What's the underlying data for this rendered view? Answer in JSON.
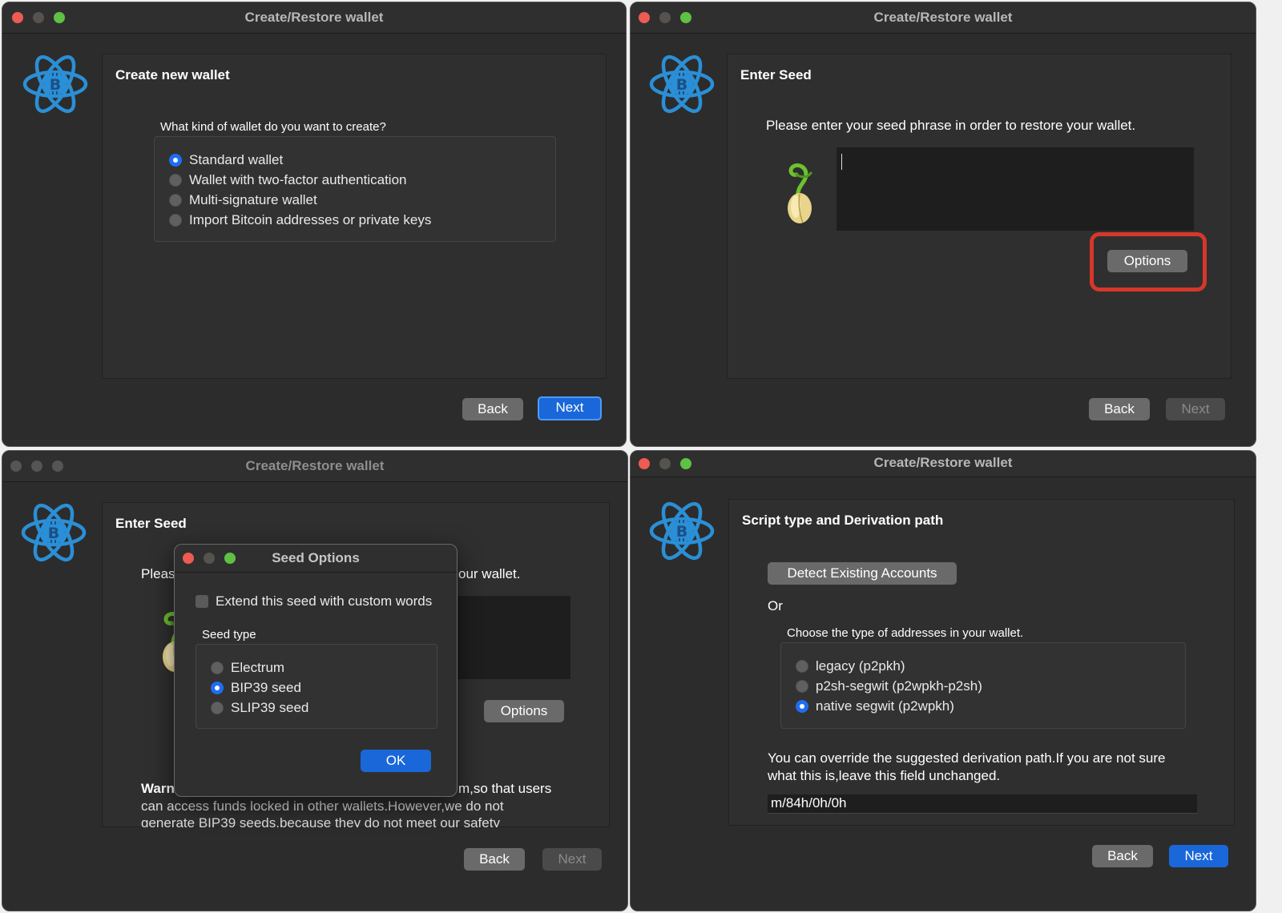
{
  "windows": {
    "top_left": {
      "title": "Create/Restore wallet",
      "heading": "Create new wallet",
      "question": "What kind of wallet do you want to create?",
      "options": [
        {
          "label": "Standard wallet",
          "checked": true
        },
        {
          "label": "Wallet with two-factor authentication",
          "checked": false
        },
        {
          "label": "Multi-signature wallet",
          "checked": false
        },
        {
          "label": "Import Bitcoin addresses or private keys",
          "checked": false
        }
      ],
      "back_label": "Back",
      "next_label": "Next"
    },
    "top_right": {
      "title": "Create/Restore wallet",
      "heading": "Enter Seed",
      "instruction": "Please enter your seed phrase in order to restore your wallet.",
      "seed_value": "",
      "options_label": "Options",
      "back_label": "Back",
      "next_label": "Next",
      "highlight_color": "#d6372a"
    },
    "bottom_left": {
      "title": "Create/Restore wallet",
      "heading": "Enter Seed",
      "instruction_left": "Pleas",
      "instruction_right": "our wallet.",
      "options_label": "Options",
      "warning_bold": "Warn",
      "warning_line1_right": "m,so that users",
      "warning_line2": "can access funds locked in other wallets.However,we do not",
      "warning_line3": "generate BIP39 seeds,because they do not meet our safety",
      "back_label": "Back",
      "next_label": "Next",
      "dialog": {
        "title": "Seed Options",
        "extend_label": "Extend this seed with custom words",
        "extend_checked": false,
        "seed_type_label": "Seed type",
        "seed_types": [
          {
            "label": "Electrum",
            "checked": false
          },
          {
            "label": "BIP39 seed",
            "checked": true
          },
          {
            "label": "SLIP39 seed",
            "checked": false
          }
        ],
        "ok_label": "OK"
      }
    },
    "bottom_right": {
      "title": "Create/Restore wallet",
      "heading": "Script type and Derivation path",
      "detect_label": "Detect Existing Accounts",
      "or_label": "Or",
      "choose_label": "Choose the type of addresses in your wallet.",
      "script_types": [
        {
          "label": "legacy (p2pkh)",
          "checked": false
        },
        {
          "label": "p2sh-segwit (p2wpkh-p2sh)",
          "checked": false
        },
        {
          "label": "native segwit (p2wpkh)",
          "checked": true
        }
      ],
      "override_line1": "You can override the suggested derivation path.If you are not sure",
      "override_line2": "what this is,leave this field unchanged.",
      "derivation_path": "m/84h/0h/0h",
      "back_label": "Back",
      "next_label": "Next"
    }
  },
  "colors": {
    "accent_blue": "#1967d9",
    "electrum_logo": "#2a8fd6",
    "window_bg": "#2c2c2c"
  },
  "icons": {
    "logo": "electrum-bitcoin-atom-icon",
    "seed": "sprouting-seed-icon"
  }
}
